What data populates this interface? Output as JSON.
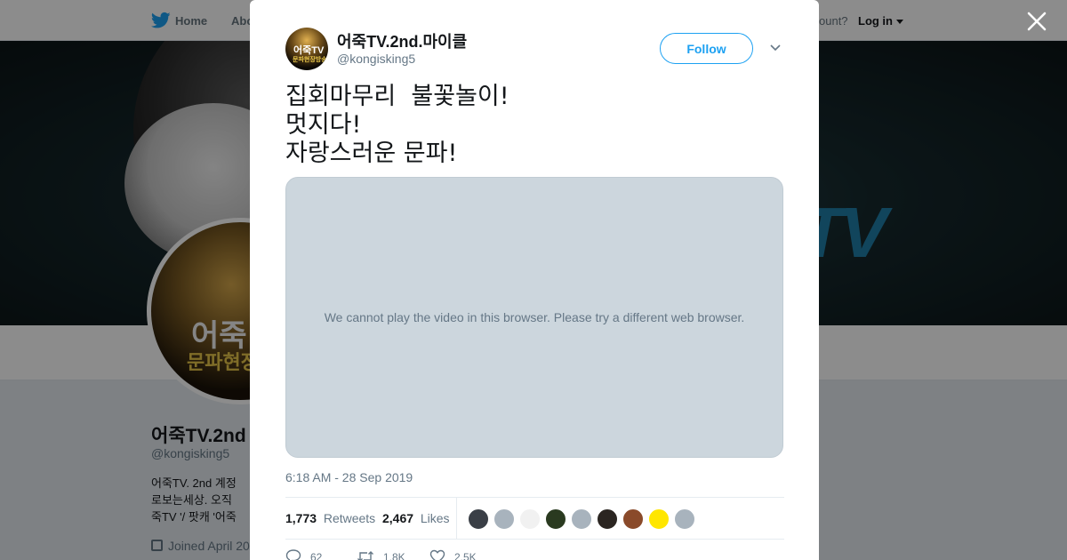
{
  "topnav": {
    "home_label": "Home",
    "about_label": "Abo",
    "account_text": "ccount?",
    "login_label": "Log in",
    "icons": [
      "twitter-bird-icon",
      "caret-down-icon"
    ]
  },
  "profile": {
    "name": "어죽TV.2nd",
    "handle": "@kongisking5",
    "bio_lines": [
      "어죽TV. 2nd 계정",
      "로보는세상. 오직",
      "죽TV '/ 팟캐 '어죽"
    ],
    "joined": "Joined April 20",
    "banner_text": "TV",
    "avatar_text_top": "어죽",
    "avatar_text_bottom": "문파현장"
  },
  "tweet": {
    "author_name": "어죽TV.2nd.마이클",
    "author_handle": "@kongisking5",
    "avatar_text_top": "어죽TV",
    "avatar_text_bottom": "문파현장방송",
    "follow_label": "Follow",
    "text": "집회마무리  불꽃놀이!\n멋지다!\n자랑스러운 문파!",
    "video_message": "We cannot play the video in this browser. Please try a different web browser.",
    "timestamp": "6:18 AM - 28 Sep 2019",
    "retweets_count": "1,773",
    "retweets_label": "Retweets",
    "likes_count": "2,467",
    "likes_label": "Likes",
    "replies_count": "62",
    "retweet_action_count": "1.8K",
    "like_action_count": "2.5K",
    "liker_avatar_colors": [
      "#3a3f46",
      "#a8b3bd",
      "#f1f1f1",
      "#2a3a20",
      "#a8b3bd",
      "#2b2521",
      "#8a4a2a",
      "#ffe600",
      "#a8b3bd"
    ]
  },
  "colors": {
    "accent": "#1da1f2",
    "video_bg": "#ccd6dd",
    "secondary_text": "#657786"
  }
}
